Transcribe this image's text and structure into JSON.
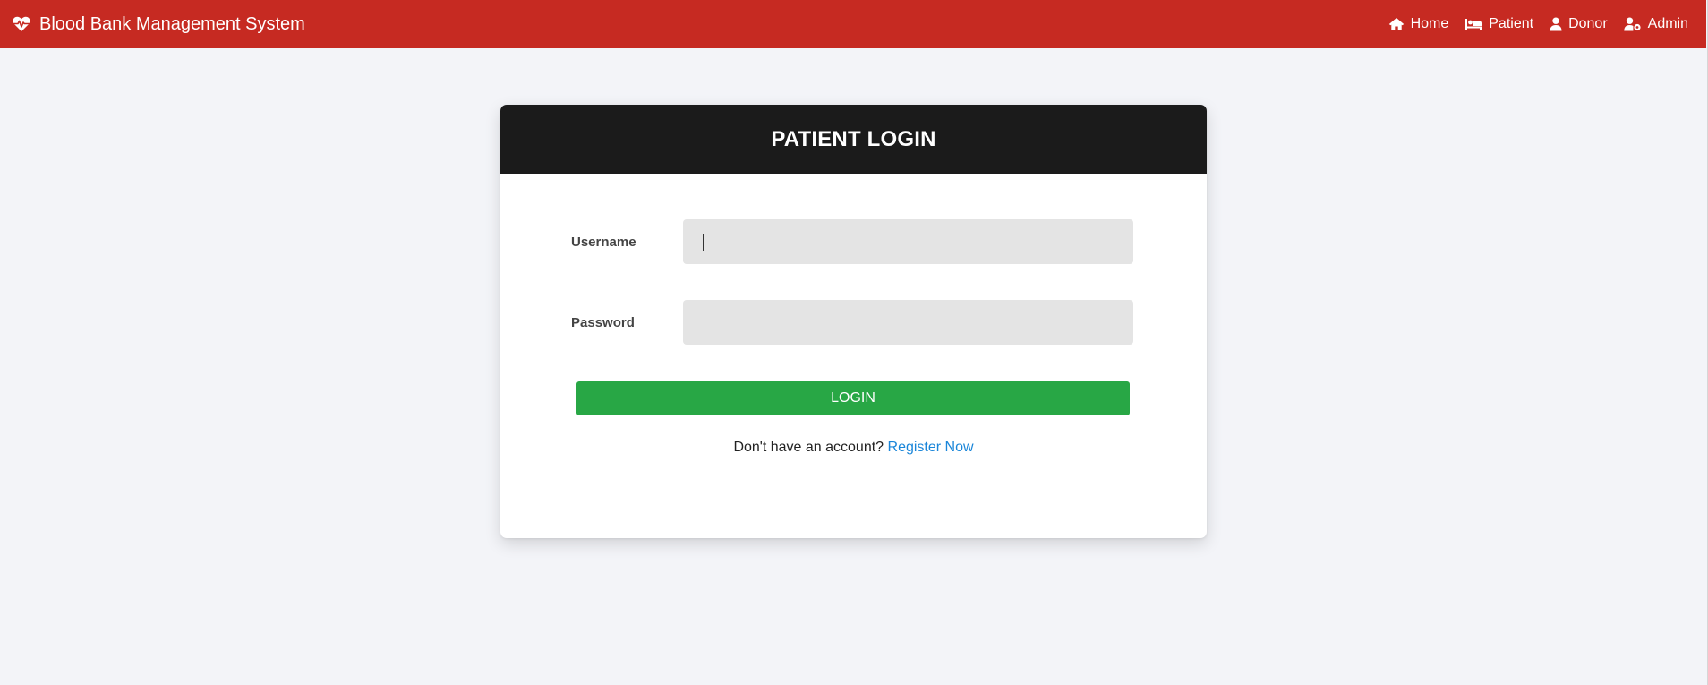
{
  "navbar": {
    "brand": "Blood Bank Management System",
    "brand_icon": "heartbeat-icon",
    "links": [
      {
        "label": "Home",
        "icon": "home-icon"
      },
      {
        "label": "Patient",
        "icon": "bed-icon"
      },
      {
        "label": "Donor",
        "icon": "user-icon"
      },
      {
        "label": "Admin",
        "icon": "user-cog-icon"
      }
    ]
  },
  "login_card": {
    "title": "PATIENT LOGIN",
    "username_label": "Username",
    "username_value": "",
    "password_label": "Password",
    "password_value": "",
    "submit_label": "LOGIN",
    "register_prompt": "Don't have an account?",
    "register_link": "Register Now"
  },
  "colors": {
    "navbar_bg": "#c62a22",
    "card_header_bg": "#1b1b1b",
    "button_bg": "#28a745",
    "link": "#1a86d9",
    "page_bg": "#f3f4f8"
  }
}
